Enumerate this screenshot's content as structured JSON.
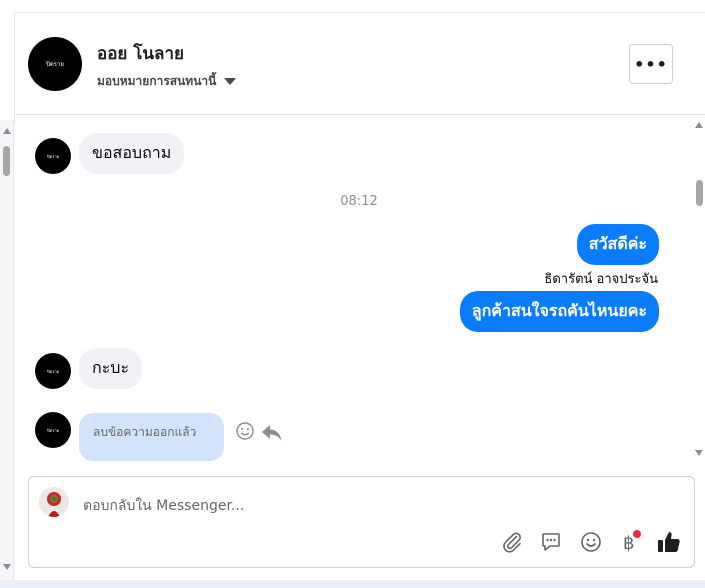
{
  "header": {
    "avatar_text": "ปิดราย",
    "contact_name": "ออย โนลาย",
    "assign_label": "มอบหมายการสนทนานี้",
    "more_label": "•••"
  },
  "messages": {
    "m1": {
      "avatar_text": "ปิดราย",
      "text": "ขอสอบถาม"
    },
    "time": "08:12",
    "out1": "สวัสดีค่ะ",
    "sender": "ธิดารัตน์ อาจประจัน",
    "out2": "ลูกค้าสนใจรถคันไหนยคะ",
    "m2": {
      "avatar_text": "ปิดราย",
      "text": "กะบะ"
    },
    "m3": {
      "avatar_text": "ปิดราย",
      "deleted_text": "ลบข้อความออกแล้ว"
    }
  },
  "composer": {
    "placeholder": "ตอบกลับใน Messenger...",
    "icons": [
      "paperclip-icon",
      "saved-reply-icon",
      "emoji-icon",
      "baht-payment-icon",
      "thumbs-up-icon"
    ]
  },
  "colors": {
    "outgoing_bubble": "#0a7cff",
    "incoming_bubble": "#f0f2f5",
    "deleted_bubble": "#d3e3fb",
    "notification_dot": "#f02849"
  }
}
